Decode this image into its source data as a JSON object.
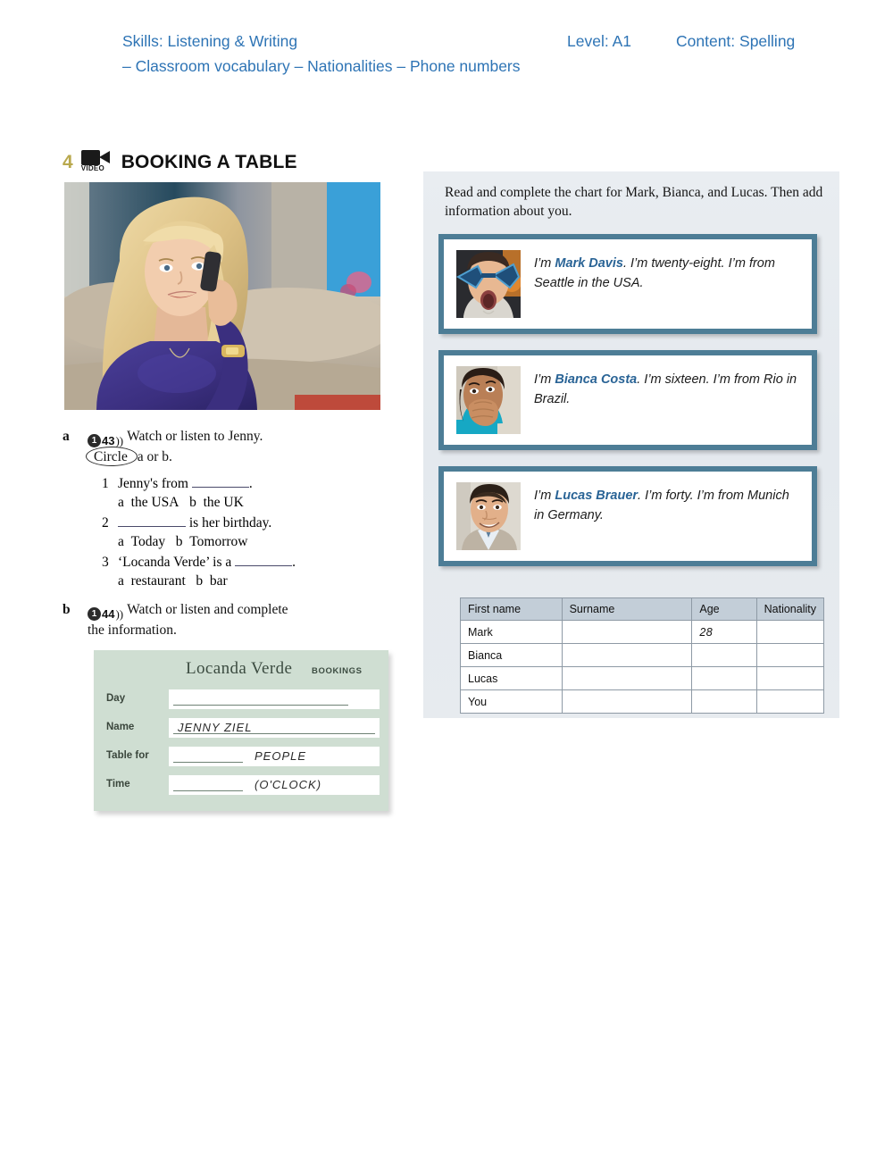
{
  "header": {
    "skills": "Skills: Listening & Writing",
    "level": "Level: A1",
    "content": "Content: Spelling",
    "topics": "– Classroom vocabulary – Nationalities – Phone numbers"
  },
  "exercise": {
    "number": "4",
    "video_badge": "VIDEO",
    "title": "BOOKING A TABLE",
    "photo_caption": "Blonde woman talking on a mobile phone on a sofa",
    "task_a": {
      "letter": "a",
      "audio": {
        "disc": "1",
        "track": "43",
        "waves": "))"
      },
      "instruction_1": "Watch or listen to Jenny.",
      "instruction_2_circled": "Circle",
      "instruction_2_rest": "a or b.",
      "questions": [
        {
          "number": "1",
          "text_before": "Jenny's from",
          "text_after": ".",
          "options": [
            {
              "letter": "a",
              "label": "the USA"
            },
            {
              "letter": "b",
              "label": "the UK"
            }
          ]
        },
        {
          "number": "2",
          "text_before": "",
          "text_after": "is her birthday.",
          "options": [
            {
              "letter": "a",
              "label": "Today"
            },
            {
              "letter": "b",
              "label": "Tomorrow"
            }
          ]
        },
        {
          "number": "3",
          "text_before": "‘Locanda Verde’ is a",
          "text_after": ".",
          "options": [
            {
              "letter": "a",
              "label": "restaurant"
            },
            {
              "letter": "b",
              "label": "bar"
            }
          ]
        }
      ]
    },
    "task_b": {
      "letter": "b",
      "audio": {
        "disc": "1",
        "track": "44",
        "waves": "))"
      },
      "instruction_1": "Watch or listen and complete",
      "instruction_2": "the information."
    },
    "booking_card": {
      "title": "Locanda Verde",
      "subtitle": "BOOKINGS",
      "rows": [
        {
          "label": "Day",
          "value": ""
        },
        {
          "label": "Name",
          "value": "JENNY  ZIEL"
        },
        {
          "label": "Table for",
          "value": "PEOPLE"
        },
        {
          "label": "Time",
          "value": "(O'CLOCK)"
        }
      ]
    }
  },
  "right_panel": {
    "instruction": "Read and complete the chart for Mark, Bianca, and Lucas. Then add information about you.",
    "cards": [
      {
        "photo_caption": "Young person wearing blue star-shaped sunglasses",
        "intro": "I’m ",
        "name": "Mark Davis",
        "rest": ". I’m twenty-eight. I’m from Seattle in the USA."
      },
      {
        "photo_caption": "Smiling woman with hand over her mouth wearing a teal top",
        "intro": "I’m ",
        "name": "Bianca Costa",
        "rest": ". I’m sixteen. I’m from Rio in Brazil."
      },
      {
        "photo_caption": "Smiling man with dark hair in a light blazer",
        "intro": "I’m ",
        "name": "Lucas Brauer",
        "rest": ". I’m forty. I’m from Munich in Germany."
      }
    ],
    "table": {
      "headers": [
        "First name",
        "Surname",
        "Age",
        "Nationality"
      ],
      "rows": [
        {
          "first_name": "Mark",
          "surname": "",
          "age": "28",
          "nationality": ""
        },
        {
          "first_name": "Bianca",
          "surname": "",
          "age": "",
          "nationality": ""
        },
        {
          "first_name": "Lucas",
          "surname": "",
          "age": "",
          "nationality": ""
        },
        {
          "first_name": "You",
          "surname": "",
          "age": "",
          "nationality": ""
        }
      ]
    }
  },
  "colors": {
    "header_blue": "#2e74b5",
    "card_border": "#4d7d96",
    "name_blue": "#2a6496",
    "booking_green": "#cfded2",
    "table_header": "#c3ced8",
    "exercise_number": "#b9a94e"
  }
}
